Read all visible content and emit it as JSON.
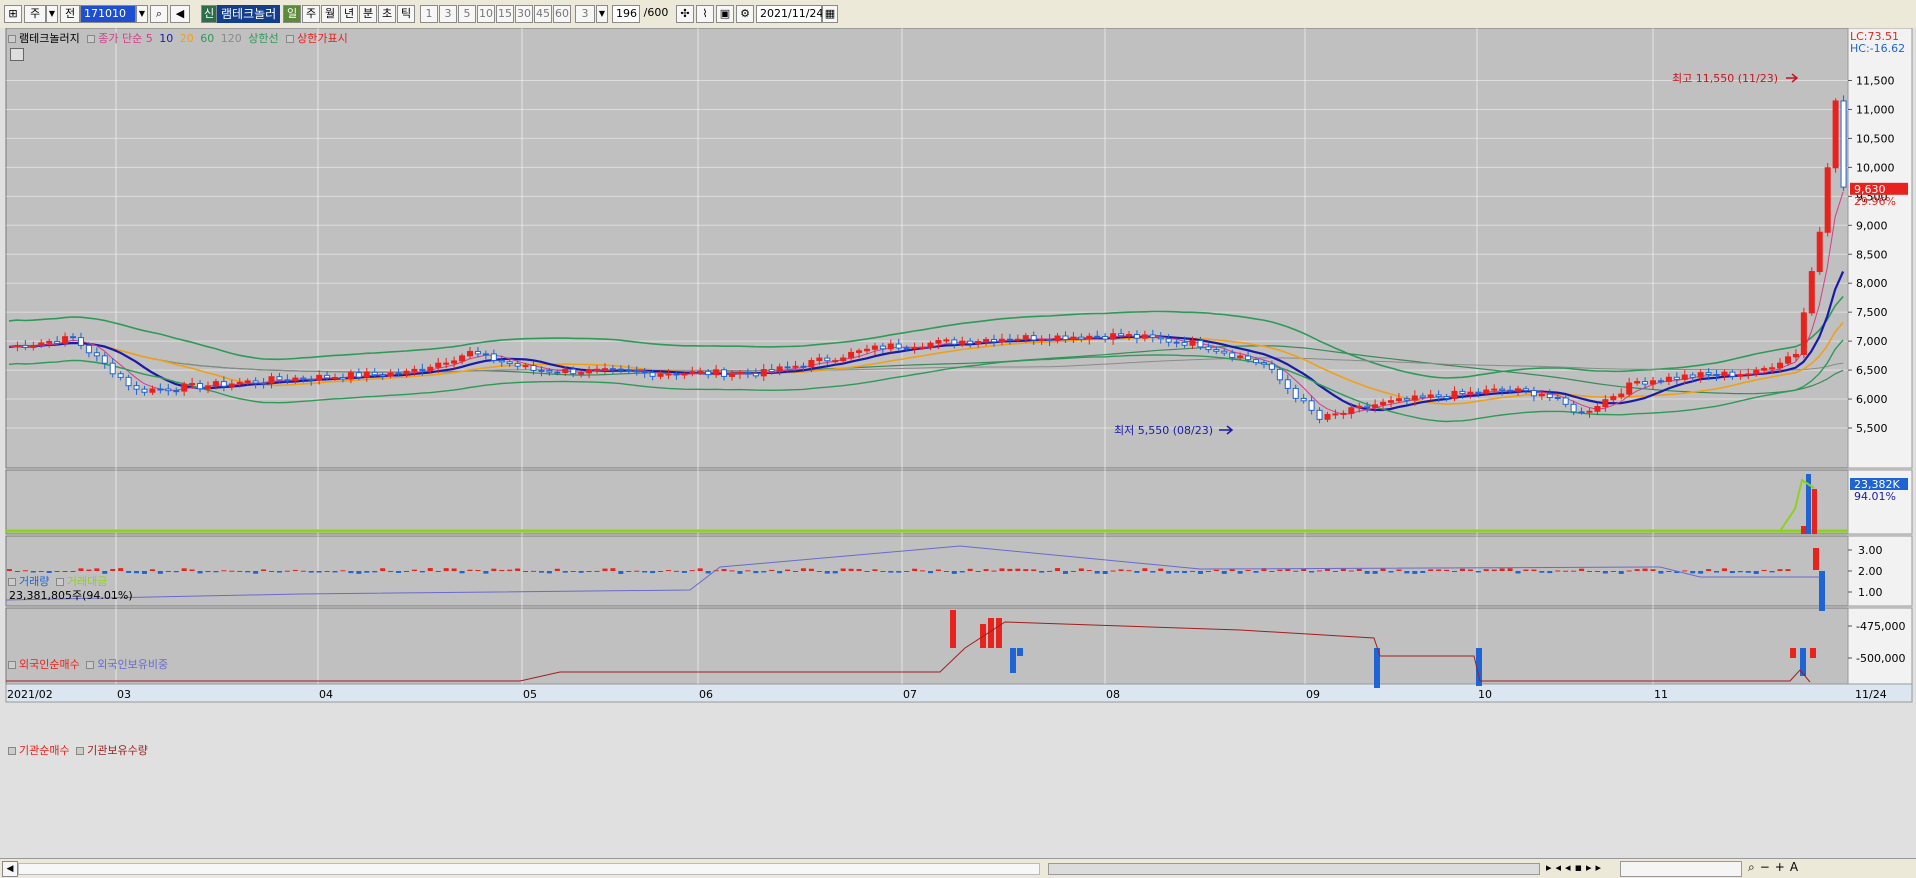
{
  "toolbar": {
    "period_tabs": [
      "주",
      "전"
    ],
    "stock_code": "171010",
    "stock_name": "램테크놀러",
    "mode_badge": "신",
    "period_buttons": [
      "일",
      "주",
      "월",
      "년",
      "분",
      "초",
      "틱"
    ],
    "minute_buttons": [
      "1",
      "3",
      "5",
      "10",
      "15",
      "30",
      "45",
      "60"
    ],
    "minute_select": "3",
    "count_value": "196",
    "count_total": "/600",
    "date_value": "2021/11/24"
  },
  "price_panel": {
    "legend": {
      "name": "램테크놀러지",
      "ma_label": "종가 단순 5",
      "ma10": "10",
      "ma20": "20",
      "ma60": "60",
      "ma120": "120",
      "upper": "상한선",
      "limit": "상한가표시"
    },
    "lc": "LC:73.51",
    "hc": "HC:-16.62",
    "y_ticks": [
      "11,500",
      "11,000",
      "10,500",
      "10,000",
      "9,500",
      "9,000",
      "8,500",
      "8,000",
      "7,500",
      "7,000",
      "6,500",
      "6,000",
      "5,500"
    ],
    "current_price": "9,630",
    "change_pct": "29.96%",
    "high_annot": "최고 11,550 (11/23)",
    "low_annot": "최저 5,550 (08/23)"
  },
  "volume_panel": {
    "legend_volume": "거래량",
    "legend_amount": "거래대금",
    "volume_value": "23,381,805주(94.01%)",
    "tag_value": "23,382K",
    "tag_pct": "94.01%"
  },
  "foreign_panel": {
    "legend_net": "외국인순매수",
    "legend_hold": "외국인보유비중",
    "y_ticks": [
      "3.00",
      "2.00",
      "1.00"
    ]
  },
  "inst_panel": {
    "legend_net": "기관순매수",
    "legend_hold": "기관보유수량",
    "y_ticks": [
      "-475,000",
      "-500,000"
    ]
  },
  "x_axis": {
    "labels": [
      "2021/02",
      "03",
      "04",
      "05",
      "06",
      "07",
      "08",
      "09",
      "10",
      "11"
    ],
    "right_label": "11/24"
  },
  "colors": {
    "up": "#e8231e",
    "down": "#1e64d4",
    "ma5": "#d43c8c",
    "ma10": "#1a1aa8",
    "ma20": "#f0a018",
    "ma60": "#2e9a58",
    "bollinger": "#2e9a58",
    "volume_line": "#8cd21e",
    "chart_bg": "#c0c0c0"
  }
}
